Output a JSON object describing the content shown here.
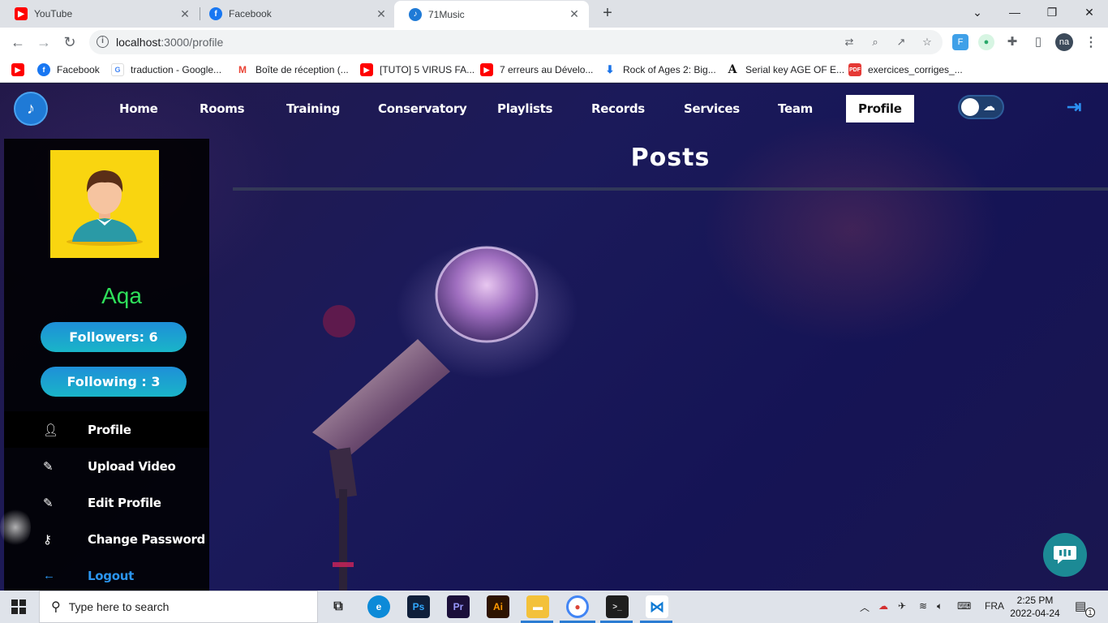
{
  "browser": {
    "tabs": [
      {
        "title": "YouTube",
        "favicon": "youtube-icon",
        "active": false
      },
      {
        "title": "Facebook",
        "favicon": "facebook-icon",
        "active": false
      },
      {
        "title": "71Music",
        "favicon": "music-note-icon",
        "active": true
      }
    ],
    "url_host": "localhost",
    "url_path": ":3000/profile",
    "profile_initials": "na",
    "bookmarks": [
      {
        "label": "",
        "icon": "youtube-icon"
      },
      {
        "label": "Facebook",
        "icon": "facebook-icon"
      },
      {
        "label": "traduction - Google...",
        "icon": "google-icon"
      },
      {
        "label": "Boîte de réception (...",
        "icon": "gmail-icon"
      },
      {
        "label": "[TUTO] 5 VIRUS FA...",
        "icon": "youtube-icon"
      },
      {
        "label": "7 erreurs au Dévelo...",
        "icon": "youtube-icon"
      },
      {
        "label": "Rock of Ages 2: Big...",
        "icon": "download-icon"
      },
      {
        "label": "Serial key AGE OF E...",
        "icon": "letter-a-icon"
      },
      {
        "label": "exercices_corriges_...",
        "icon": "pdf-icon"
      }
    ]
  },
  "site": {
    "nav": [
      "Home",
      "Rooms",
      "Training",
      "Conservatory",
      "Playlists",
      "Records",
      "Services",
      "Team",
      "Profile"
    ],
    "active_nav": "Profile",
    "colors": {
      "accent": "#2b95f0",
      "username": "#2ee05a",
      "pill_start": "#1e8fd8",
      "pill_end": "#1ab5c8"
    }
  },
  "profile": {
    "username": "Aqa",
    "followers_label": "Followers: 6",
    "following_label": "Following : 3",
    "menu": [
      {
        "label": "Profile",
        "icon": "user-icon"
      },
      {
        "label": "Upload Video",
        "icon": "edit-icon"
      },
      {
        "label": "Edit Profile",
        "icon": "edit-icon"
      },
      {
        "label": "Change Password",
        "icon": "key-icon"
      },
      {
        "label": "Logout",
        "icon": "arrow-left-icon"
      }
    ]
  },
  "main": {
    "title": "Posts"
  },
  "taskbar": {
    "search_placeholder": "Type here to search",
    "language": "FRA",
    "time": "2:25 PM",
    "date": "2022-04-24",
    "notification_count": "1"
  }
}
